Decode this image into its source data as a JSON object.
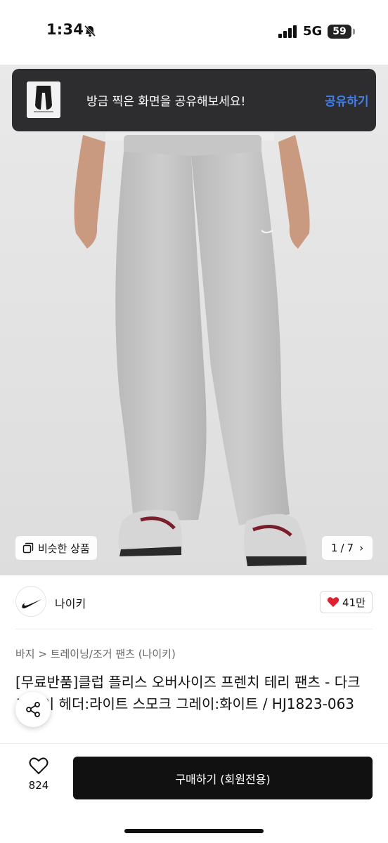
{
  "status_bar": {
    "time": "1:34",
    "network": "5G",
    "battery": "59"
  },
  "toast": {
    "message": "방금 찍은 화면을 공유해보세요!",
    "action_label": "공유하기"
  },
  "gallery": {
    "similar_label": "비슷한 상품",
    "current": "1",
    "separator": "/",
    "total": "7",
    "next_glyph": "›"
  },
  "brand": {
    "name": "나이키",
    "likes": "41만"
  },
  "breadcrumb": "바지 > 트레이닝/조거 팬츠 (나이키)",
  "product": {
    "title": "[무료반품]클럽 플리스 오버사이즈 프렌치 테리 팬츠 - 다크 그레이 헤더:라이트 스모크 그레이:화이트 / HJ1823-063"
  },
  "bottom_bar": {
    "wish_count": "824",
    "buy_label": "구매하기 (회원전용)"
  },
  "colors": {
    "toast_bg": "#2d2d2f",
    "toast_action": "#3f7ff0",
    "buy_button": "#111111",
    "heart": "#e0202d"
  },
  "icons": [
    "bell-slash-icon",
    "signal-icon",
    "copy-icon",
    "chevron-right-icon",
    "nike-swoosh-icon",
    "heart-icon",
    "share-icon",
    "heart-outline-icon"
  ]
}
